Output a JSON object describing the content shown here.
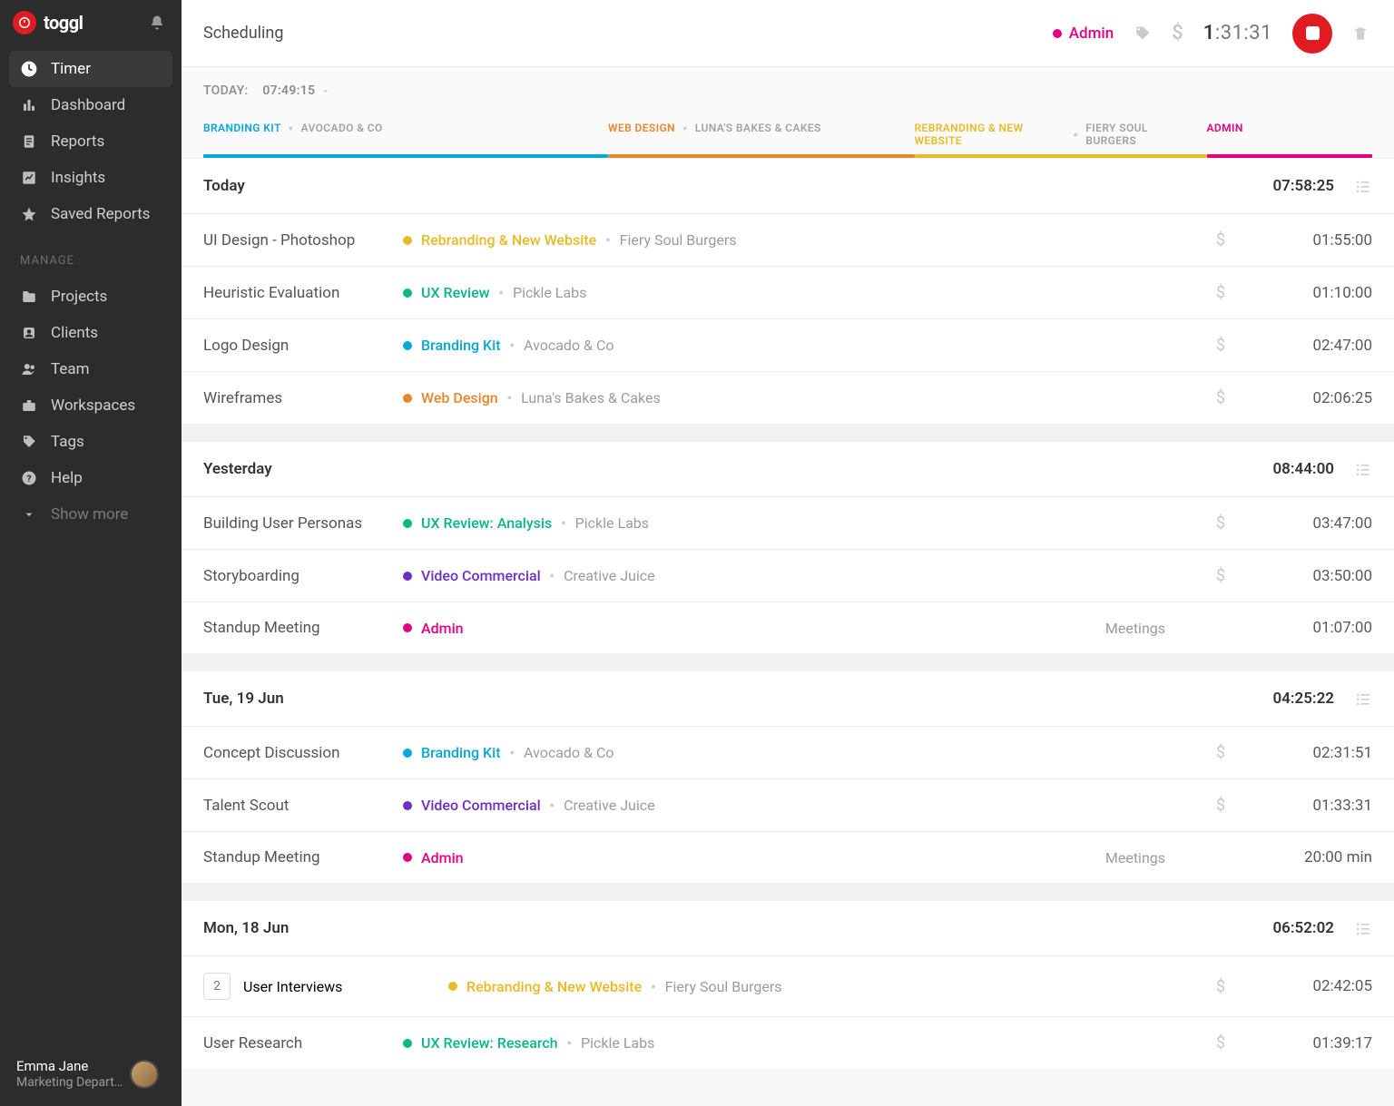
{
  "brand": {
    "name": "toggl"
  },
  "sidebar": {
    "items": [
      {
        "label": "Timer",
        "icon": "clock",
        "active": true
      },
      {
        "label": "Dashboard",
        "icon": "bars"
      },
      {
        "label": "Reports",
        "icon": "doc"
      },
      {
        "label": "Insights",
        "icon": "chart"
      },
      {
        "label": "Saved Reports",
        "icon": "star"
      }
    ],
    "manage_label": "MANAGE",
    "manage_items": [
      {
        "label": "Projects",
        "icon": "folder"
      },
      {
        "label": "Clients",
        "icon": "user"
      },
      {
        "label": "Team",
        "icon": "team"
      },
      {
        "label": "Workspaces",
        "icon": "briefcase"
      },
      {
        "label": "Tags",
        "icon": "tag"
      },
      {
        "label": "Help",
        "icon": "help"
      },
      {
        "label": "Show more",
        "icon": "chevron"
      }
    ],
    "user": {
      "name": "Emma Jane",
      "role": "Marketing Depart…"
    }
  },
  "header": {
    "title": "Scheduling",
    "project_label": "Admin",
    "project_color": "#e20082",
    "running_bold": "1",
    "running_rest": ":31:31"
  },
  "summary": {
    "label": "TODAY:",
    "value": "07:49:15",
    "segments": [
      {
        "proj": "BRANDING KIT",
        "client": "AVOCADO & CO",
        "color": "#06a8d9",
        "flex": 28
      },
      {
        "proj": "WEB DESIGN",
        "client": "LUNA'S BAKES & CAKES",
        "color": "#e7862f",
        "flex": 21
      },
      {
        "proj": "REBRANDING & NEW WEBSITE",
        "client": "FIERY SOUL BURGERS",
        "color": "#e8ba28",
        "flex": 20
      },
      {
        "proj": "ADMIN",
        "client": "",
        "color": "#e20082",
        "flex": 11
      }
    ]
  },
  "days": [
    {
      "title": "Today",
      "total": "07:58:25",
      "entries": [
        {
          "task": "UI Design - Photoshop",
          "proj": "Rebranding & New Website",
          "client": "Fiery Soul Burgers",
          "color": "#e8ba28",
          "billable": true,
          "duration": "01:55:00"
        },
        {
          "task": "Heuristic Evaluation",
          "proj": "UX Review",
          "client": "Pickle Labs",
          "color": "#0bb588",
          "billable": true,
          "duration": "01:10:00"
        },
        {
          "task": "Logo Design",
          "proj": "Branding Kit",
          "client": "Avocado & Co",
          "color": "#06a8d9",
          "billable": true,
          "duration": "02:47:00"
        },
        {
          "task": "Wireframes",
          "proj": "Web Design",
          "client": "Luna's Bakes & Cakes",
          "color": "#e7862f",
          "billable": true,
          "duration": "02:06:25"
        }
      ]
    },
    {
      "title": "Yesterday",
      "total": "08:44:00",
      "entries": [
        {
          "task": "Building User Personas",
          "proj": "UX Review: Analysis",
          "client": "Pickle Labs",
          "color": "#0bb588",
          "billable": true,
          "duration": "03:47:00"
        },
        {
          "task": "Storyboarding",
          "proj": "Video Commercial",
          "client": "Creative Juice",
          "color": "#6d2fbd",
          "billable": true,
          "duration": "03:50:00"
        },
        {
          "task": "Standup Meeting",
          "proj": "Admin",
          "client": "",
          "color": "#e20082",
          "tag": "Meetings",
          "billable": false,
          "duration": "01:07:00"
        }
      ]
    },
    {
      "title": "Tue, 19 Jun",
      "total": "04:25:22",
      "entries": [
        {
          "task": "Concept Discussion",
          "proj": "Branding Kit",
          "client": "Avocado & Co",
          "color": "#06a8d9",
          "billable": true,
          "duration": "02:31:51"
        },
        {
          "task": "Talent Scout",
          "proj": "Video Commercial",
          "client": "Creative Juice",
          "color": "#6d2fbd",
          "billable": true,
          "duration": "01:33:31"
        },
        {
          "task": "Standup Meeting",
          "proj": "Admin",
          "client": "",
          "color": "#e20082",
          "tag": "Meetings",
          "billable": false,
          "duration": "20:00 min"
        }
      ]
    },
    {
      "title": "Mon, 18 Jun",
      "total": "06:52:02",
      "entries": [
        {
          "task": "User Interviews",
          "count": "2",
          "proj": "Rebranding & New Website",
          "client": "Fiery Soul Burgers",
          "color": "#e8ba28",
          "billable": true,
          "duration": "02:42:05"
        },
        {
          "task": "User Research",
          "proj": "UX Review: Research",
          "client": "Pickle Labs",
          "color": "#0bb588",
          "billable": true,
          "duration": "01:39:17"
        }
      ]
    }
  ]
}
